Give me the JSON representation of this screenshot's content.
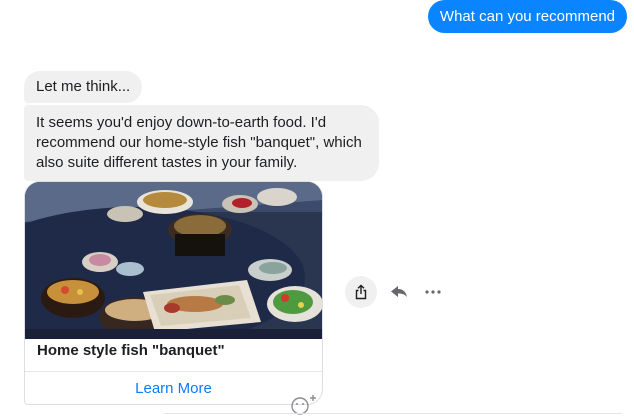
{
  "messages": {
    "outgoing_1": "What can you recommend",
    "incoming_1": "Let me think...",
    "incoming_2": "It seems you'd enjoy down-to-earth food. I'd recommend our home-style fish \"banquet\", which also suite different tastes in your family."
  },
  "card": {
    "image": "photo of a Japanese home-style fish meal on a table",
    "title": "Home style fish \"banquet\"",
    "button_label": "Learn More"
  },
  "actions": {
    "share_icon": "share-icon",
    "reply_icon": "reply-icon",
    "more_icon": "more-icon",
    "react_icon": "add-reaction-icon"
  },
  "colors": {
    "outgoing_bubble": "#0a84ff",
    "incoming_bubble": "#f0f0f0",
    "link": "#0a7cff"
  }
}
